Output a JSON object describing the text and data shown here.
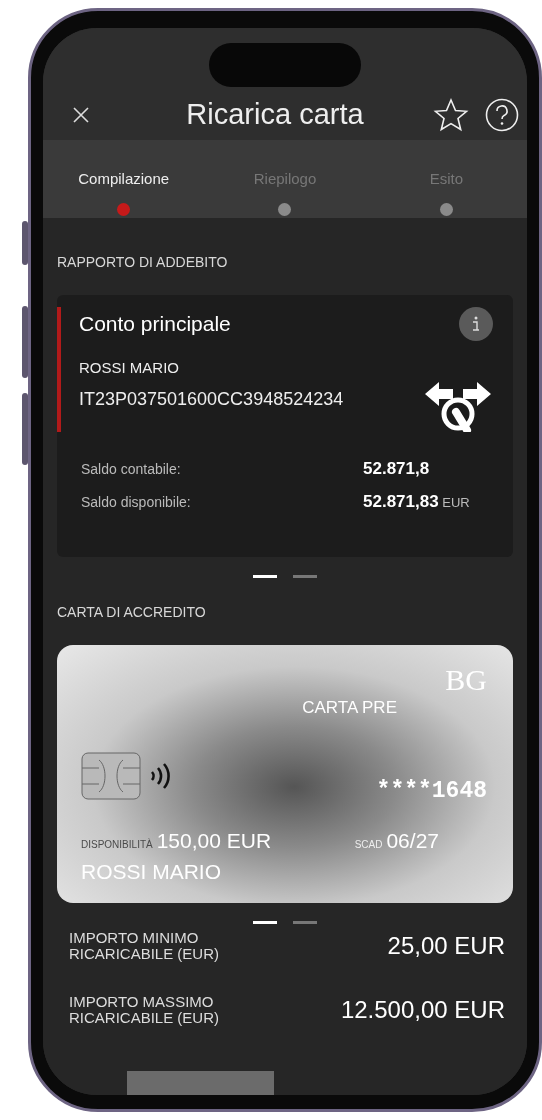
{
  "header": {
    "title": "Ricarica carta"
  },
  "steps": [
    {
      "label": "Compilazione",
      "selected": true
    },
    {
      "label": "Riepilogo",
      "selected": false
    },
    {
      "label": "Esito",
      "selected": false
    }
  ],
  "debit_section": {
    "title": "RAPPORTO DI ADDEBITO"
  },
  "account": {
    "name": "Conto principale",
    "holder": "ROSSI MARIO",
    "iban": "IT23P037501600CC3948524234",
    "balances": [
      {
        "label": "Saldo contabile:",
        "amount": "52.871,8"
      },
      {
        "label": "Saldo disponibile:",
        "amount": "52.871,83",
        "currency": "EUR"
      }
    ]
  },
  "account_pager": [
    {
      "selected": true
    },
    {
      "selected": false
    }
  ],
  "credit_section": {
    "title": "CARTA DI ACCREDITO"
  },
  "card": {
    "brand": "BG",
    "type_label": "CARTA PRE",
    "masked_number": "****1648",
    "availability_label": "DISPONIBILITÀ",
    "availability": "150,00 EUR",
    "expiry_label": "SCAD",
    "expiry": "06/27",
    "holder": "ROSSI MARIO"
  },
  "card_pager": [
    {
      "selected": true
    },
    {
      "selected": false
    }
  ],
  "limits": [
    {
      "label": "IMPORTO MINIMO RICARICABILE (EUR)",
      "value": "25,00 EUR"
    },
    {
      "label": "IMPORTO MASSIMO RICARICABILE (EUR)",
      "value": "12.500,00 EUR"
    }
  ]
}
